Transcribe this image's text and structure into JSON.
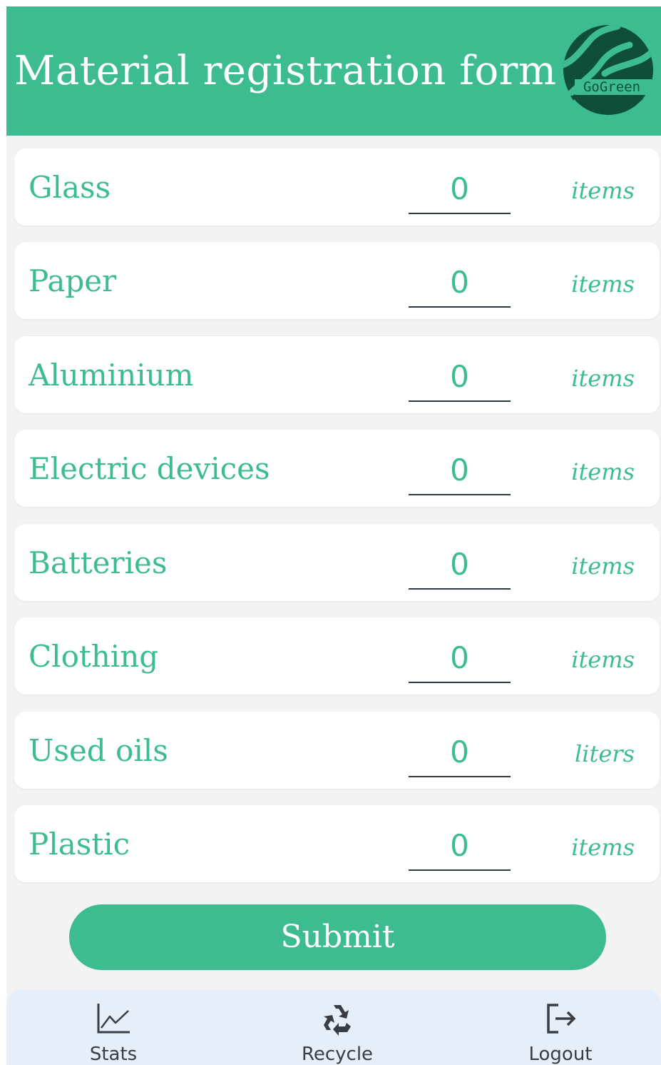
{
  "header": {
    "title": "Material registration form",
    "logo_text": "GoGreen",
    "background_color": "#3dbd8f",
    "logo_color": "#0f4f3a"
  },
  "materials": [
    {
      "label": "Glass",
      "value": "0",
      "unit": "items"
    },
    {
      "label": "Paper",
      "value": "0",
      "unit": "items"
    },
    {
      "label": "Aluminium",
      "value": "0",
      "unit": "items"
    },
    {
      "label": "Electric devices",
      "value": "0",
      "unit": "items"
    },
    {
      "label": "Batteries",
      "value": "0",
      "unit": "items"
    },
    {
      "label": "Clothing",
      "value": "0",
      "unit": "items"
    },
    {
      "label": "Used oils",
      "value": "0",
      "unit": "liters"
    },
    {
      "label": "Plastic",
      "value": "0",
      "unit": "items"
    }
  ],
  "submit": {
    "label": "Submit"
  },
  "nav": {
    "items": [
      {
        "label": "Stats",
        "icon": "line-chart-icon"
      },
      {
        "label": "Recycle",
        "icon": "recycle-icon"
      },
      {
        "label": "Logout",
        "icon": "logout-icon"
      }
    ],
    "background_color": "#e5eef9"
  },
  "colors": {
    "accent": "#3dbd8f",
    "page_background": "#f4f3f4",
    "input_underline": "#2f3a40",
    "nav_text": "#3a3d44"
  }
}
